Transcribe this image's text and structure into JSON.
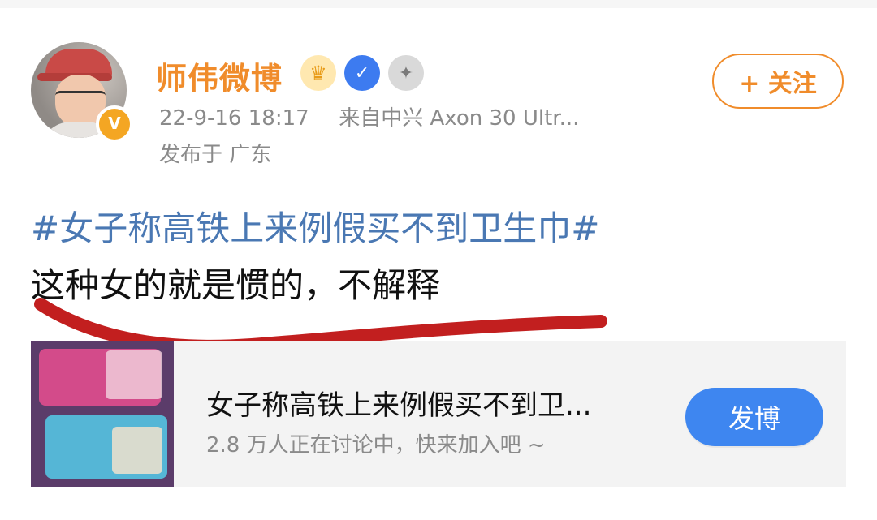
{
  "post": {
    "author_name": "师伟微博",
    "badges": [
      {
        "icon": "crown-icon"
      },
      {
        "icon": "verified-shield-icon"
      },
      {
        "icon": "medal-icon"
      }
    ],
    "verified_icon": "v-badge-icon",
    "timestamp": "22-9-16 18:17",
    "source": "来自中兴 Axon 30 Ultr...",
    "location": "发布于  广东",
    "follow_label": "+ 关注",
    "hashtag": "#女子称高铁上来例假买不到卫生巾#",
    "content": "这种女的就是惯的，不解释",
    "colors": {
      "name": "#f08c2b",
      "follow_border": "#f08c2b",
      "hashtag": "#4a78b3",
      "underline": "#c21f1f"
    }
  },
  "topic_card": {
    "title": "女子称高铁上来例假买不到卫...",
    "subtitle": "2.8 万人正在讨论中，快来加入吧 ~",
    "post_button": "发博",
    "colors": {
      "post_button_bg": "#3e86f0"
    }
  }
}
